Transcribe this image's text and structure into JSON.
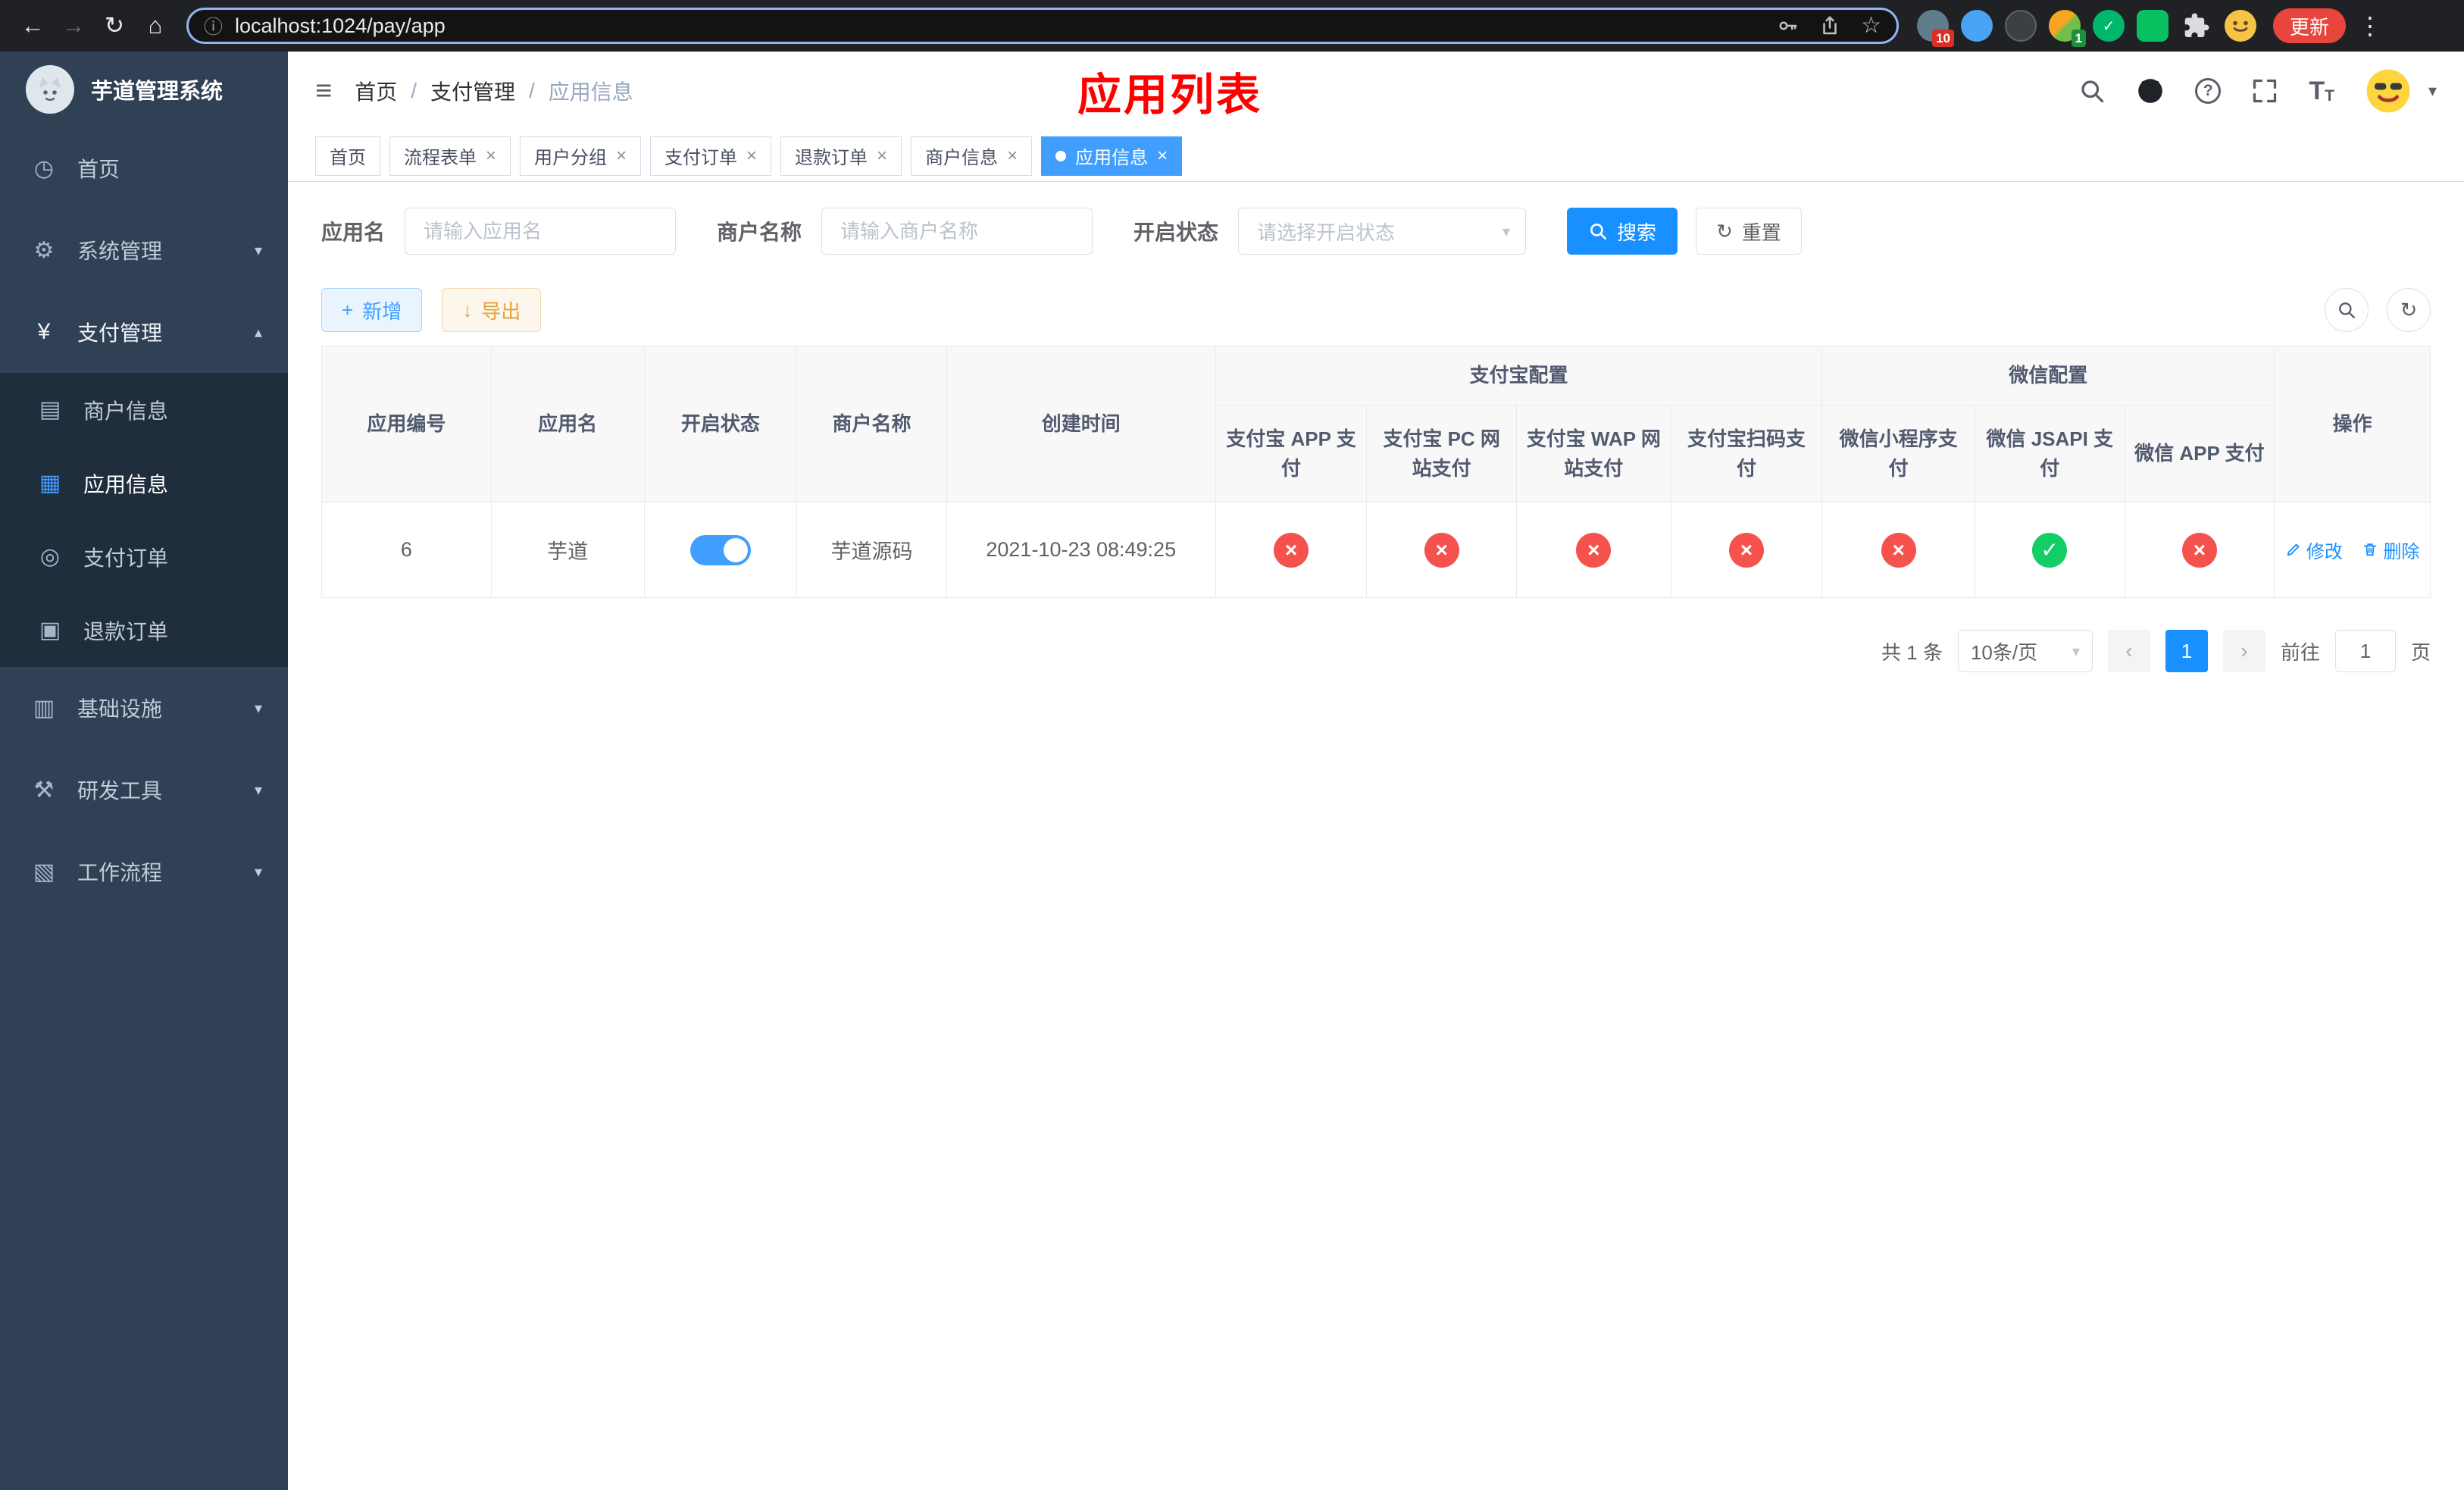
{
  "browser": {
    "url": "localhost:1024/pay/app",
    "update_label": "更新",
    "ext_badge_1": "10",
    "ext_badge_2": "1"
  },
  "colors": {
    "primary": "#409eff",
    "primary_strong": "#1890ff",
    "success": "#13ce66",
    "danger": "#f5524d",
    "warning": "#e6a23c",
    "overlay_title_red": "#ff0000",
    "sidebar_bg": "#304156",
    "submenu_bg": "#1f2d3d"
  },
  "icons": {
    "back": "←",
    "forward": "→",
    "reload": "↻",
    "home": "⌂",
    "info": "ⓘ",
    "star": "☆",
    "kebab": "⋮",
    "hamburger": "≡",
    "caret_down": "▾",
    "chevron_down": "▾",
    "chevron_up": "▴",
    "close": "×",
    "plus": "+",
    "download": "↓",
    "refresh": "↻",
    "check": "✓",
    "cross": "×",
    "question": "?",
    "font": "T",
    "prev": "‹",
    "next": "›",
    "dashboard": "◷",
    "gear": "⚙",
    "yen": "¥",
    "card": "▤",
    "grid": "▦",
    "order": "◎",
    "doc": "▣",
    "infra": "▥",
    "tool": "⚒",
    "flow": "▧"
  },
  "sidebar": {
    "title": "芋道管理系统",
    "items": [
      {
        "label": "首页"
      },
      {
        "label": "系统管理"
      },
      {
        "label": "支付管理"
      },
      {
        "label": "基础设施"
      },
      {
        "label": "研发工具"
      },
      {
        "label": "工作流程"
      }
    ],
    "submenu": [
      {
        "label": "商户信息"
      },
      {
        "label": "应用信息"
      },
      {
        "label": "支付订单"
      },
      {
        "label": "退款订单"
      }
    ]
  },
  "header": {
    "breadcrumb": [
      "首页",
      "支付管理",
      "应用信息"
    ],
    "overlay_title": "应用列表"
  },
  "tabs": [
    {
      "label": "首页"
    },
    {
      "label": "流程表单"
    },
    {
      "label": "用户分组"
    },
    {
      "label": "支付订单"
    },
    {
      "label": "退款订单"
    },
    {
      "label": "商户信息"
    },
    {
      "label": "应用信息"
    }
  ],
  "filters": {
    "app_name_label": "应用名",
    "app_name_placeholder": "请输入应用名",
    "merchant_label": "商户名称",
    "merchant_placeholder": "请输入商户名称",
    "status_label": "开启状态",
    "status_placeholder": "请选择开启状态",
    "search_label": "搜索",
    "reset_label": "重置"
  },
  "toolbar": {
    "add_label": "新增",
    "export_label": "导出"
  },
  "table": {
    "groups": {
      "alipay": "支付宝配置",
      "wechat": "微信配置"
    },
    "columns": {
      "id": "应用编号",
      "name": "应用名",
      "status": "开启状态",
      "merchant": "商户名称",
      "created": "创建时间",
      "alipay_app": "支付宝 APP 支付",
      "alipay_pc": "支付宝 PC 网站支付",
      "alipay_wap": "支付宝 WAP 网站支付",
      "alipay_qr": "支付宝扫码支付",
      "wx_mini": "微信小程序支付",
      "wx_jsapi": "微信 JSAPI 支付",
      "wx_app": "微信 APP 支付",
      "actions": "操作"
    },
    "rows": [
      {
        "id": "6",
        "name": "芋道",
        "enabled": true,
        "merchant": "芋道源码",
        "created": "2021-10-23 08:49:25",
        "alipay_app": false,
        "alipay_pc": false,
        "alipay_wap": false,
        "alipay_qr": false,
        "wx_mini": false,
        "wx_jsapi": true,
        "wx_app": false,
        "edit_label": "修改",
        "delete_label": "删除"
      }
    ]
  },
  "pagination": {
    "total": "共 1 条",
    "page_size": "10条/页",
    "page": "1",
    "goto_label": "前往",
    "goto_value": "1",
    "unit_label": "页"
  }
}
